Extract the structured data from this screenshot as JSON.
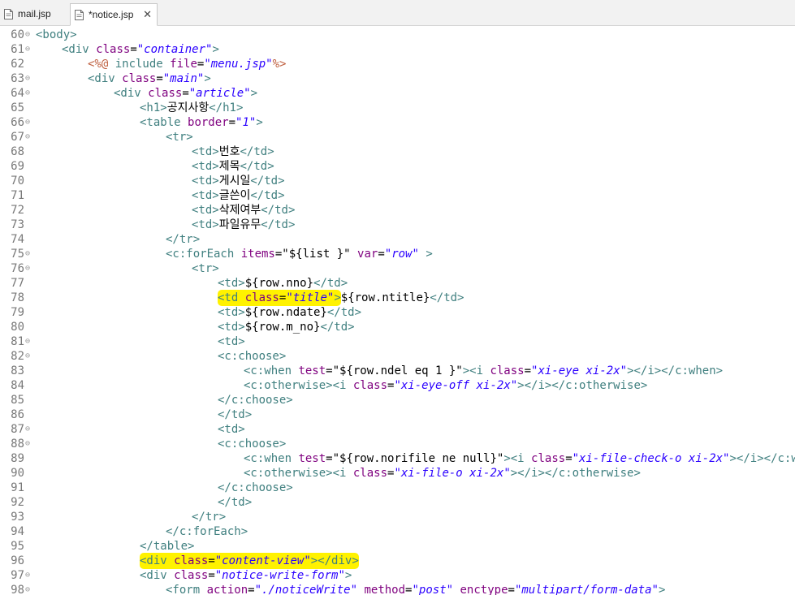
{
  "tabs": [
    {
      "label": "mail.jsp",
      "active": false
    },
    {
      "label": "*notice.jsp",
      "active": true,
      "close": "✕"
    }
  ],
  "colors": {
    "tag": "#3f7f7f",
    "attr": "#7f007f",
    "value": "#2a00ff",
    "jsp_directive": "#bf5f3f",
    "highlight": "#fff200",
    "line_number": "#787878"
  },
  "lines": [
    {
      "num": "60",
      "fold": true,
      "indent": 0,
      "tokens": [
        [
          "t",
          "<body>"
        ]
      ]
    },
    {
      "num": "61",
      "fold": true,
      "indent": 1,
      "tokens": [
        [
          "t",
          "<div "
        ],
        [
          "a",
          "class"
        ],
        [
          "p",
          "="
        ],
        [
          "v",
          "\"container\""
        ],
        [
          "t",
          ">"
        ]
      ]
    },
    {
      "num": "62",
      "fold": false,
      "indent": 2,
      "tokens": [
        [
          "e",
          "<%@ "
        ],
        [
          "t",
          "include "
        ],
        [
          "a",
          "file"
        ],
        [
          "p",
          "="
        ],
        [
          "v",
          "\"menu.jsp\""
        ],
        [
          "e",
          "%>"
        ]
      ]
    },
    {
      "num": "63",
      "fold": true,
      "indent": 2,
      "tokens": [
        [
          "t",
          "<div "
        ],
        [
          "a",
          "class"
        ],
        [
          "p",
          "="
        ],
        [
          "v",
          "\"main\""
        ],
        [
          "t",
          ">"
        ]
      ]
    },
    {
      "num": "64",
      "fold": true,
      "indent": 3,
      "tokens": [
        [
          "t",
          "<div "
        ],
        [
          "a",
          "class"
        ],
        [
          "p",
          "="
        ],
        [
          "v",
          "\"article\""
        ],
        [
          "t",
          ">"
        ]
      ]
    },
    {
      "num": "65",
      "fold": false,
      "indent": 4,
      "tokens": [
        [
          "t",
          "<h1>"
        ],
        [
          "p",
          "공지사항"
        ],
        [
          "t",
          "</h1>"
        ]
      ]
    },
    {
      "num": "66",
      "fold": true,
      "indent": 4,
      "tokens": [
        [
          "t",
          "<table "
        ],
        [
          "a",
          "border"
        ],
        [
          "p",
          "="
        ],
        [
          "v",
          "\"1\""
        ],
        [
          "t",
          ">"
        ]
      ]
    },
    {
      "num": "67",
      "fold": true,
      "indent": 5,
      "tokens": [
        [
          "t",
          "<tr>"
        ]
      ]
    },
    {
      "num": "68",
      "fold": false,
      "indent": 6,
      "tokens": [
        [
          "t",
          "<td>"
        ],
        [
          "p",
          "번호"
        ],
        [
          "t",
          "</td>"
        ]
      ]
    },
    {
      "num": "69",
      "fold": false,
      "indent": 6,
      "tokens": [
        [
          "t",
          "<td>"
        ],
        [
          "p",
          "제목"
        ],
        [
          "t",
          "</td>"
        ]
      ]
    },
    {
      "num": "70",
      "fold": false,
      "indent": 6,
      "tokens": [
        [
          "t",
          "<td>"
        ],
        [
          "p",
          "게시일"
        ],
        [
          "t",
          "</td>"
        ]
      ]
    },
    {
      "num": "71",
      "fold": false,
      "indent": 6,
      "tokens": [
        [
          "t",
          "<td>"
        ],
        [
          "p",
          "글쓴이"
        ],
        [
          "t",
          "</td>"
        ]
      ]
    },
    {
      "num": "72",
      "fold": false,
      "indent": 6,
      "tokens": [
        [
          "t",
          "<td>"
        ],
        [
          "p",
          "삭제여부"
        ],
        [
          "t",
          "</td>"
        ]
      ]
    },
    {
      "num": "73",
      "fold": false,
      "indent": 6,
      "tokens": [
        [
          "t",
          "<td>"
        ],
        [
          "p",
          "파일유무"
        ],
        [
          "t",
          "</td>"
        ]
      ]
    },
    {
      "num": "74",
      "fold": false,
      "indent": 5,
      "tokens": [
        [
          "t",
          "</tr>"
        ]
      ]
    },
    {
      "num": "75",
      "fold": true,
      "indent": 5,
      "tokens": [
        [
          "t",
          "<c:forEach "
        ],
        [
          "a",
          "items"
        ],
        [
          "p",
          "=\"${list }\" "
        ],
        [
          "a",
          "var"
        ],
        [
          "p",
          "="
        ],
        [
          "v",
          "\"row\""
        ],
        [
          "t",
          " >"
        ]
      ]
    },
    {
      "num": "76",
      "fold": true,
      "indent": 6,
      "tokens": [
        [
          "t",
          "<tr>"
        ]
      ]
    },
    {
      "num": "77",
      "fold": false,
      "indent": 7,
      "tokens": [
        [
          "t",
          "<td>"
        ],
        [
          "p",
          "${row.nno}"
        ],
        [
          "t",
          "</td>"
        ]
      ]
    },
    {
      "num": "78",
      "fold": false,
      "indent": 7,
      "tokens": [
        [
          "t",
          "<td "
        ],
        [
          "a",
          "class"
        ],
        [
          "p",
          "="
        ],
        [
          "v",
          "\"title\""
        ],
        [
          "t",
          ">"
        ],
        [
          "p",
          "${row.ntitle}"
        ],
        [
          "t",
          "</td>"
        ]
      ],
      "highlight": {
        "start": 0,
        "end": 5
      }
    },
    {
      "num": "79",
      "fold": false,
      "indent": 7,
      "tokens": [
        [
          "t",
          "<td>"
        ],
        [
          "p",
          "${row.ndate}"
        ],
        [
          "t",
          "</td>"
        ]
      ]
    },
    {
      "num": "80",
      "fold": false,
      "indent": 7,
      "tokens": [
        [
          "t",
          "<td>"
        ],
        [
          "p",
          "${row.m_no}"
        ],
        [
          "t",
          "</td>"
        ]
      ]
    },
    {
      "num": "81",
      "fold": true,
      "indent": 7,
      "tokens": [
        [
          "t",
          "<td>"
        ]
      ]
    },
    {
      "num": "82",
      "fold": true,
      "indent": 7,
      "tokens": [
        [
          "t",
          "<c:choose>"
        ]
      ]
    },
    {
      "num": "83",
      "fold": false,
      "indent": 8,
      "tokens": [
        [
          "t",
          "<c:when "
        ],
        [
          "a",
          "test"
        ],
        [
          "p",
          "=\"${row.ndel eq 1 }\""
        ],
        [
          "t",
          "><i "
        ],
        [
          "a",
          "class"
        ],
        [
          "p",
          "="
        ],
        [
          "v",
          "\"xi-eye xi-2x\""
        ],
        [
          "t",
          "></i></c:when>"
        ]
      ]
    },
    {
      "num": "84",
      "fold": false,
      "indent": 8,
      "tokens": [
        [
          "t",
          "<c:otherwise><i "
        ],
        [
          "a",
          "class"
        ],
        [
          "p",
          "="
        ],
        [
          "v",
          "\"xi-eye-off xi-2x\""
        ],
        [
          "t",
          "></i></c:otherwise>"
        ]
      ]
    },
    {
      "num": "85",
      "fold": false,
      "indent": 7,
      "tokens": [
        [
          "t",
          "</c:choose>"
        ]
      ]
    },
    {
      "num": "86",
      "fold": false,
      "indent": 7,
      "tokens": [
        [
          "t",
          "</td>"
        ]
      ]
    },
    {
      "num": "87",
      "fold": true,
      "indent": 7,
      "tokens": [
        [
          "t",
          "<td>"
        ]
      ]
    },
    {
      "num": "88",
      "fold": true,
      "indent": 7,
      "tokens": [
        [
          "t",
          "<c:choose>"
        ]
      ]
    },
    {
      "num": "89",
      "fold": false,
      "indent": 8,
      "tokens": [
        [
          "t",
          "<c:when "
        ],
        [
          "a",
          "test"
        ],
        [
          "p",
          "=\"${row.norifile ne null}\""
        ],
        [
          "t",
          "><i "
        ],
        [
          "a",
          "class"
        ],
        [
          "p",
          "="
        ],
        [
          "v",
          "\"xi-file-check-o xi-2x\""
        ],
        [
          "t",
          "></i></c:when>"
        ]
      ]
    },
    {
      "num": "90",
      "fold": false,
      "indent": 8,
      "tokens": [
        [
          "t",
          "<c:otherwise><i "
        ],
        [
          "a",
          "class"
        ],
        [
          "p",
          "="
        ],
        [
          "v",
          "\"xi-file-o xi-2x\""
        ],
        [
          "t",
          "></i></c:otherwise>"
        ]
      ]
    },
    {
      "num": "91",
      "fold": false,
      "indent": 7,
      "tokens": [
        [
          "t",
          "</c:choose>"
        ]
      ]
    },
    {
      "num": "92",
      "fold": false,
      "indent": 7,
      "tokens": [
        [
          "t",
          "</td>"
        ]
      ]
    },
    {
      "num": "93",
      "fold": false,
      "indent": 6,
      "tokens": [
        [
          "t",
          "</tr>"
        ]
      ]
    },
    {
      "num": "94",
      "fold": false,
      "indent": 5,
      "tokens": [
        [
          "t",
          "</c:forEach>"
        ]
      ]
    },
    {
      "num": "95",
      "fold": false,
      "indent": 4,
      "tokens": [
        [
          "t",
          "</table>"
        ]
      ]
    },
    {
      "num": "96",
      "fold": false,
      "indent": 4,
      "tokens": [
        [
          "t",
          "<div "
        ],
        [
          "a",
          "class"
        ],
        [
          "p",
          "="
        ],
        [
          "v",
          "\"content-view\""
        ],
        [
          "t",
          "></div>"
        ]
      ],
      "highlight": {
        "start": 0,
        "end": 5
      }
    },
    {
      "num": "97",
      "fold": true,
      "indent": 4,
      "tokens": [
        [
          "t",
          "<div "
        ],
        [
          "a",
          "class"
        ],
        [
          "p",
          "="
        ],
        [
          "v",
          "\"notice-write-form\""
        ],
        [
          "t",
          ">"
        ]
      ]
    },
    {
      "num": "98",
      "fold": true,
      "indent": 5,
      "tokens": [
        [
          "t",
          "<form "
        ],
        [
          "a",
          "action"
        ],
        [
          "p",
          "="
        ],
        [
          "v",
          "\"./noticeWrite\""
        ],
        [
          "p",
          " "
        ],
        [
          "a",
          "method"
        ],
        [
          "p",
          "="
        ],
        [
          "v",
          "\"post\""
        ],
        [
          "p",
          " "
        ],
        [
          "a",
          "enctype"
        ],
        [
          "p",
          "="
        ],
        [
          "v",
          "\"multipart/form-data\""
        ],
        [
          "t",
          ">"
        ]
      ]
    }
  ]
}
